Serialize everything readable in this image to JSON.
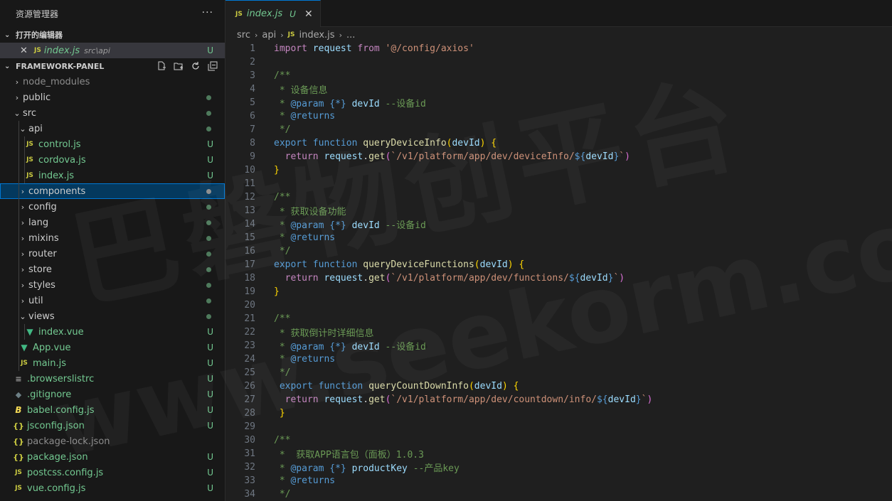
{
  "explorer": {
    "title": "资源管理器",
    "more": "···",
    "open_editors_label": "打开的编辑器",
    "open_editor": {
      "name": "index.js",
      "path": "src\\api",
      "status": "U"
    },
    "project_label": "FRAMEWORK-PANEL",
    "tree": [
      {
        "label": "node_modules",
        "indent": 0,
        "kind": "folder",
        "open": false,
        "status": ""
      },
      {
        "label": "public",
        "indent": 0,
        "kind": "folder",
        "open": false,
        "status": "dot"
      },
      {
        "label": "src",
        "indent": 0,
        "kind": "folder",
        "open": true,
        "status": "dot"
      },
      {
        "label": "api",
        "indent": 1,
        "kind": "folder",
        "open": true,
        "status": "dot"
      },
      {
        "label": "control.js",
        "indent": 2,
        "kind": "js",
        "status": "U"
      },
      {
        "label": "cordova.js",
        "indent": 2,
        "kind": "js",
        "status": "U"
      },
      {
        "label": "index.js",
        "indent": 2,
        "kind": "js",
        "status": "U"
      },
      {
        "label": "components",
        "indent": 1,
        "kind": "folder",
        "open": false,
        "status": "dot",
        "selected": true
      },
      {
        "label": "config",
        "indent": 1,
        "kind": "folder",
        "open": false,
        "status": "dot"
      },
      {
        "label": "lang",
        "indent": 1,
        "kind": "folder",
        "open": false,
        "status": "dot"
      },
      {
        "label": "mixins",
        "indent": 1,
        "kind": "folder",
        "open": false,
        "status": "dot"
      },
      {
        "label": "router",
        "indent": 1,
        "kind": "folder",
        "open": false,
        "status": "dot"
      },
      {
        "label": "store",
        "indent": 1,
        "kind": "folder",
        "open": false,
        "status": "dot"
      },
      {
        "label": "styles",
        "indent": 1,
        "kind": "folder",
        "open": false,
        "status": "dot"
      },
      {
        "label": "util",
        "indent": 1,
        "kind": "folder",
        "open": false,
        "status": "dot"
      },
      {
        "label": "views",
        "indent": 1,
        "kind": "folder",
        "open": true,
        "status": "dot"
      },
      {
        "label": "index.vue",
        "indent": 2,
        "kind": "vue",
        "status": "U"
      },
      {
        "label": "App.vue",
        "indent": 1,
        "kind": "vue",
        "status": "U"
      },
      {
        "label": "main.js",
        "indent": 1,
        "kind": "js",
        "status": "U"
      },
      {
        "label": ".browserslistrc",
        "indent": 0,
        "kind": "list",
        "status": "U"
      },
      {
        "label": ".gitignore",
        "indent": 0,
        "kind": "git",
        "status": "U"
      },
      {
        "label": "babel.config.js",
        "indent": 0,
        "kind": "babel",
        "status": "U"
      },
      {
        "label": "jsconfig.json",
        "indent": 0,
        "kind": "json",
        "status": "U"
      },
      {
        "label": "package-lock.json",
        "indent": 0,
        "kind": "json",
        "status": ""
      },
      {
        "label": "package.json",
        "indent": 0,
        "kind": "json",
        "status": "U"
      },
      {
        "label": "postcss.config.js",
        "indent": 0,
        "kind": "js",
        "status": "U"
      },
      {
        "label": "vue.config.js",
        "indent": 0,
        "kind": "js",
        "status": "U"
      }
    ]
  },
  "editor": {
    "tab": {
      "name": "index.js",
      "status": "U"
    },
    "breadcrumb": [
      "src",
      "api",
      "index.js",
      "..."
    ],
    "lines": [
      [
        [
          "kw",
          "import"
        ],
        [
          "var",
          " request "
        ],
        [
          "kw",
          "from"
        ],
        [
          "str",
          " '@/config/axios'"
        ]
      ],
      [],
      [
        [
          "cm",
          "/**"
        ]
      ],
      [
        [
          "cm",
          " * 设备信息"
        ]
      ],
      [
        [
          "cm",
          " * "
        ],
        [
          "kb",
          "@param"
        ],
        [
          "cm",
          " "
        ],
        [
          "kb",
          "{*}"
        ],
        [
          "cm",
          " "
        ],
        [
          "var",
          "devId"
        ],
        [
          "cm",
          " --设备id"
        ]
      ],
      [
        [
          "cm",
          " * "
        ],
        [
          "kb",
          "@returns"
        ]
      ],
      [
        [
          "cm",
          " */"
        ]
      ],
      [
        [
          "kb",
          "export"
        ],
        [
          "txt",
          " "
        ],
        [
          "kb",
          "function"
        ],
        [
          "txt",
          " "
        ],
        [
          "fn",
          "queryDeviceInfo"
        ],
        [
          "br1",
          "("
        ],
        [
          "var",
          "devId"
        ],
        [
          "br1",
          ")"
        ],
        [
          "txt",
          " "
        ],
        [
          "br1",
          "{"
        ]
      ],
      [
        [
          "txt",
          "  "
        ],
        [
          "kw",
          "return"
        ],
        [
          "txt",
          " "
        ],
        [
          "var",
          "request"
        ],
        [
          "txt",
          "."
        ],
        [
          "fn",
          "get"
        ],
        [
          "br2",
          "("
        ],
        [
          "str",
          "`/v1/platform/app/dev/deviceInfo/"
        ],
        [
          "kb",
          "${"
        ],
        [
          "var",
          "devId"
        ],
        [
          "kb",
          "}"
        ],
        [
          "str",
          "`"
        ],
        [
          "br2",
          ")"
        ]
      ],
      [
        [
          "br1",
          "}"
        ]
      ],
      [],
      [
        [
          "cm",
          "/**"
        ]
      ],
      [
        [
          "cm",
          " * 获取设备功能"
        ]
      ],
      [
        [
          "cm",
          " * "
        ],
        [
          "kb",
          "@param"
        ],
        [
          "cm",
          " "
        ],
        [
          "kb",
          "{*}"
        ],
        [
          "cm",
          " "
        ],
        [
          "var",
          "devId"
        ],
        [
          "cm",
          " --设备id"
        ]
      ],
      [
        [
          "cm",
          " * "
        ],
        [
          "kb",
          "@returns"
        ]
      ],
      [
        [
          "cm",
          " */"
        ]
      ],
      [
        [
          "kb",
          "export"
        ],
        [
          "txt",
          " "
        ],
        [
          "kb",
          "function"
        ],
        [
          "txt",
          " "
        ],
        [
          "fn",
          "queryDeviceFunctions"
        ],
        [
          "br1",
          "("
        ],
        [
          "var",
          "devId"
        ],
        [
          "br1",
          ")"
        ],
        [
          "txt",
          " "
        ],
        [
          "br1",
          "{"
        ]
      ],
      [
        [
          "txt",
          "  "
        ],
        [
          "kw",
          "return"
        ],
        [
          "txt",
          " "
        ],
        [
          "var",
          "request"
        ],
        [
          "txt",
          "."
        ],
        [
          "fn",
          "get"
        ],
        [
          "br2",
          "("
        ],
        [
          "str",
          "`/v1/platform/app/dev/functions/"
        ],
        [
          "kb",
          "${"
        ],
        [
          "var",
          "devId"
        ],
        [
          "kb",
          "}"
        ],
        [
          "str",
          "`"
        ],
        [
          "br2",
          ")"
        ]
      ],
      [
        [
          "br1",
          "}"
        ]
      ],
      [],
      [
        [
          "cm",
          "/**"
        ]
      ],
      [
        [
          "cm",
          " * 获取倒计时详细信息"
        ]
      ],
      [
        [
          "cm",
          " * "
        ],
        [
          "kb",
          "@param"
        ],
        [
          "cm",
          " "
        ],
        [
          "kb",
          "{*}"
        ],
        [
          "cm",
          " "
        ],
        [
          "var",
          "devId"
        ],
        [
          "cm",
          " --设备id"
        ]
      ],
      [
        [
          "cm",
          " * "
        ],
        [
          "kb",
          "@returns"
        ]
      ],
      [
        [
          "cm",
          " */"
        ]
      ],
      [
        [
          "txt",
          " "
        ],
        [
          "kb",
          "export"
        ],
        [
          "txt",
          " "
        ],
        [
          "kb",
          "function"
        ],
        [
          "txt",
          " "
        ],
        [
          "fn",
          "queryCountDownInfo"
        ],
        [
          "br1",
          "("
        ],
        [
          "var",
          "devId"
        ],
        [
          "br1",
          ")"
        ],
        [
          "txt",
          " "
        ],
        [
          "br1",
          "{"
        ]
      ],
      [
        [
          "txt",
          "  "
        ],
        [
          "kw",
          "return"
        ],
        [
          "txt",
          " "
        ],
        [
          "var",
          "request"
        ],
        [
          "txt",
          "."
        ],
        [
          "fn",
          "get"
        ],
        [
          "br2",
          "("
        ],
        [
          "str",
          "`/v1/platform/app/dev/countdown/info/"
        ],
        [
          "kb",
          "${"
        ],
        [
          "var",
          "devId"
        ],
        [
          "kb",
          "}"
        ],
        [
          "str",
          "`"
        ],
        [
          "br2",
          ")"
        ]
      ],
      [
        [
          "txt",
          " "
        ],
        [
          "br1",
          "}"
        ]
      ],
      [],
      [
        [
          "cm",
          "/**"
        ]
      ],
      [
        [
          "cm",
          " *  获取APP语言包（面板）1.0.3"
        ]
      ],
      [
        [
          "cm",
          " * "
        ],
        [
          "kb",
          "@param"
        ],
        [
          "cm",
          " "
        ],
        [
          "kb",
          "{*}"
        ],
        [
          "cm",
          " "
        ],
        [
          "var",
          "productKey"
        ],
        [
          "cm",
          " --产品key"
        ]
      ],
      [
        [
          "cm",
          " * "
        ],
        [
          "kb",
          "@returns"
        ]
      ],
      [
        [
          "cm",
          " */"
        ]
      ]
    ]
  },
  "watermark": {
    "text1": "巴磐物创平台",
    "text2": "www.seekorm.com"
  },
  "colors": {
    "accent": "#0078d4",
    "untracked": "#73c991",
    "sidebar_bg": "#181818",
    "editor_bg": "#1f1f1f"
  }
}
